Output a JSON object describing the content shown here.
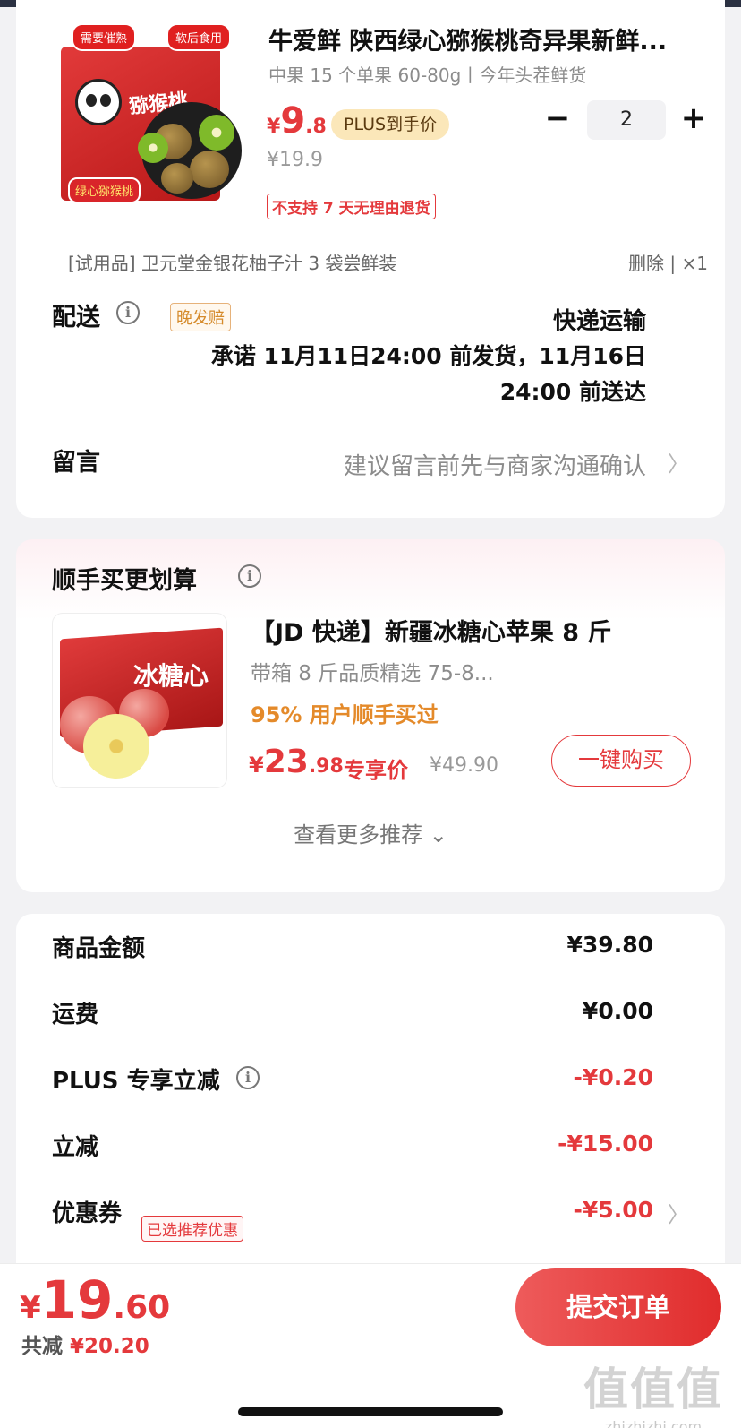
{
  "product": {
    "image_tags": [
      "需要催熟",
      "软后食用",
      "绿心猕猴桃"
    ],
    "image_box_text": "猕猴桃",
    "title": "牛爱鲜 陕西绿心猕猴桃奇异果新鲜...",
    "spec": "中果 15 个单果 60-80g丨今年头茬鲜货",
    "price": {
      "yen": "¥",
      "int": "9",
      "dec": ".8"
    },
    "plus_badge": "PLUS到手价",
    "original_price": "¥19.9",
    "no_return_tag": "不支持 7 天无理由退货",
    "quantity": "2",
    "minus_label": "−",
    "plus_label": "+"
  },
  "gift": {
    "text": "[试用品] 卫元堂金银花柚子汁 3 袋尝鲜装",
    "action": "删除 | ×1"
  },
  "delivery": {
    "label": "配送",
    "info_icon": "i",
    "late_tag": "晚发赔",
    "method": "快递运输",
    "promise": "承诺 11月11日24:00 前发货，11月16日24:00 前送达"
  },
  "message": {
    "label": "留言",
    "hint": "建议留言前先与商家沟通确认",
    "chevron": "〉"
  },
  "recommend": {
    "title": "顺手买更划算",
    "info_icon": "i",
    "image_box_text": "冰糖心",
    "name": "【JD 快递】新疆冰糖心苹果 8 斤",
    "spec": "带箱 8 斤品质精选 75-8...",
    "bought": "95% 用户顺手买过",
    "price": {
      "yen": "¥",
      "int": "23",
      "dec": ".98"
    },
    "price_label": "专享价",
    "original_price": "¥49.90",
    "buy_button": "一键购买",
    "more": "查看更多推荐 ⌄"
  },
  "summary": {
    "rows": [
      {
        "label": "商品金额",
        "value": "¥39.80"
      },
      {
        "label": "运费",
        "value": "¥0.00"
      },
      {
        "label": "PLUS 专享立减",
        "value": "-¥0.20"
      },
      {
        "label": "立减",
        "value": "-¥15.00"
      },
      {
        "label": "优惠券",
        "value": "-¥5.00"
      }
    ],
    "coupon_tag": "已选推荐优惠",
    "info_icon": "i",
    "chevron": "〉"
  },
  "footer": {
    "total": {
      "yen": "¥",
      "int": "19",
      "dec": ".60"
    },
    "saved_label": "共减 ",
    "saved_amount": "¥20.20",
    "submit": "提交订单",
    "watermark_big": "值值值",
    "watermark_small": "zhizhizhi.com"
  },
  "colors": {
    "accent_red": "#e4393c",
    "plus_gold": "#fbe7b9",
    "bought_orange": "#e48a2a"
  }
}
